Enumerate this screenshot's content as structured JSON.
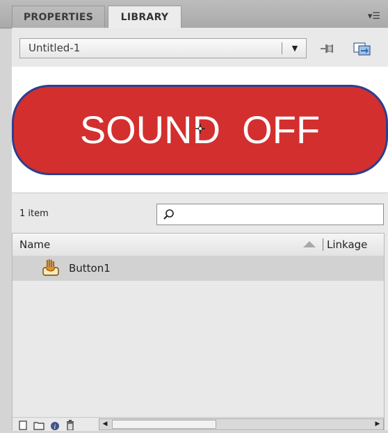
{
  "tabs": [
    {
      "label": "PROPERTIES",
      "active": false
    },
    {
      "label": "LIBRARY",
      "active": true
    }
  ],
  "panel_menu_icon": "panel-menu-icon",
  "document_selector": {
    "value": "Untitled-1"
  },
  "toolbar_icons": [
    "pin-icon",
    "new-library-panel-icon"
  ],
  "preview": {
    "button_text": "SOUND  OFF",
    "colors": {
      "fill": "#d32f2f",
      "border": "#2b3f8f",
      "text": "#ffffff"
    }
  },
  "library": {
    "item_count": "1 item",
    "search": {
      "value": "",
      "placeholder": ""
    },
    "columns": {
      "name": "Name",
      "linkage": "Linkage"
    },
    "items": [
      {
        "label": "Button1",
        "icon": "button-symbol-icon",
        "selected": true
      }
    ]
  },
  "bottom_icons": [
    "new-symbol-icon",
    "new-folder-icon",
    "properties-icon",
    "delete-icon"
  ]
}
